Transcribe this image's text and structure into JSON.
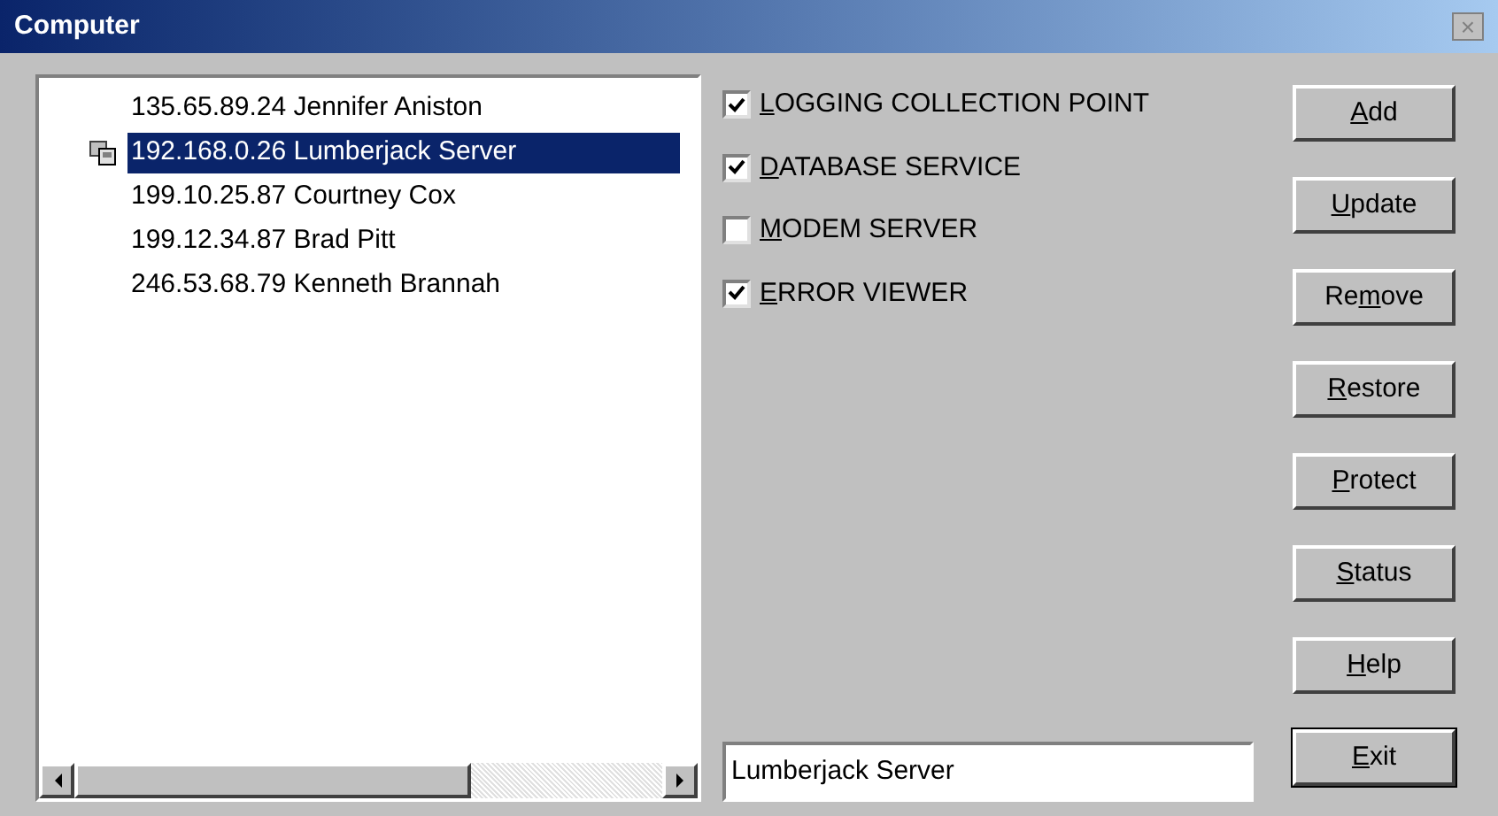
{
  "window": {
    "title": "Computer",
    "close": "×"
  },
  "list": {
    "items": [
      {
        "text": "135.65.89.24 Jennifer Aniston",
        "selected": false,
        "icon": false
      },
      {
        "text": "192.168.0.26 Lumberjack Server",
        "selected": true,
        "icon": true
      },
      {
        "text": "199.10.25.87 Courtney Cox",
        "selected": false,
        "icon": false
      },
      {
        "text": "199.12.34.87 Brad Pitt",
        "selected": false,
        "icon": false
      },
      {
        "text": "246.53.68.79 Kenneth Brannah",
        "selected": false,
        "icon": false
      }
    ]
  },
  "services": [
    {
      "label": [
        {
          "text": "L",
          "underline": true
        },
        {
          "text": "OGGING COLLECTION POINT",
          "underline": false
        }
      ],
      "checked": true
    },
    {
      "label": [
        {
          "text": "D",
          "underline": true
        },
        {
          "text": "ATABASE SERVICE",
          "underline": false
        }
      ],
      "checked": true
    },
    {
      "label": [
        {
          "text": "M",
          "underline": true
        },
        {
          "text": "ODEM SERVER",
          "underline": false
        }
      ],
      "checked": false
    },
    {
      "label": [
        {
          "text": "E",
          "underline": true
        },
        {
          "text": "RROR VIEWER",
          "underline": false
        }
      ],
      "checked": true
    }
  ],
  "name_field": {
    "value": "Lumberjack Server"
  },
  "buttons": [
    {
      "label": [
        {
          "text": "A",
          "underline": true
        },
        {
          "text": "dd",
          "underline": false
        }
      ],
      "default": false
    },
    {
      "label": [
        {
          "text": "U",
          "underline": true
        },
        {
          "text": "pdate",
          "underline": false
        }
      ],
      "default": false
    },
    {
      "label": [
        {
          "text": "Re",
          "underline": false
        },
        {
          "text": "m",
          "underline": true
        },
        {
          "text": "ove",
          "underline": false
        }
      ],
      "default": false
    },
    {
      "label": [
        {
          "text": "R",
          "underline": true
        },
        {
          "text": "estore",
          "underline": false
        }
      ],
      "default": false
    },
    {
      "label": [
        {
          "text": "P",
          "underline": true
        },
        {
          "text": "rotect",
          "underline": false
        }
      ],
      "default": false
    },
    {
      "label": [
        {
          "text": "S",
          "underline": true
        },
        {
          "text": "tatus",
          "underline": false
        }
      ],
      "default": false
    },
    {
      "label": [
        {
          "text": "H",
          "underline": true
        },
        {
          "text": "elp",
          "underline": false
        }
      ],
      "default": false
    },
    {
      "label": [
        {
          "text": "E",
          "underline": true
        },
        {
          "text": "xit",
          "underline": false
        }
      ],
      "default": true
    }
  ]
}
